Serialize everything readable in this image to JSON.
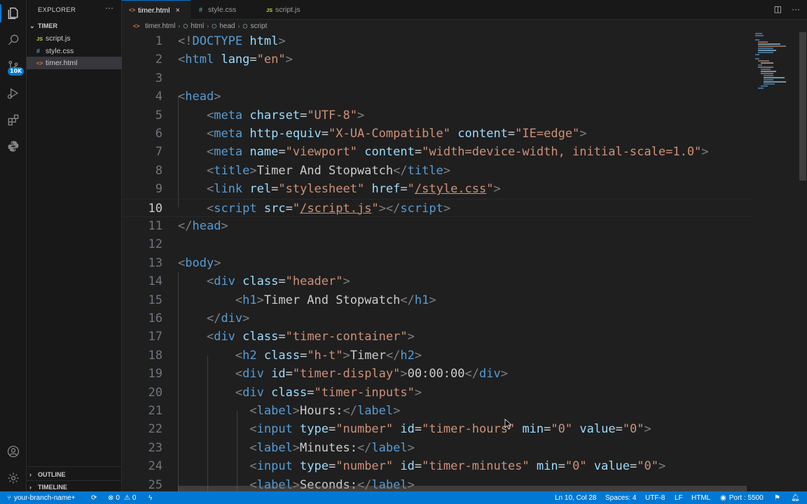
{
  "sidebar": {
    "title": "EXPLORER",
    "more": "···",
    "folder": "TIMER",
    "files": [
      {
        "icon": "JS",
        "name": "script.js"
      },
      {
        "icon": "#",
        "name": "style.css"
      },
      {
        "icon": "<>",
        "name": "timer.html"
      }
    ],
    "outline": "OUTLINE",
    "timeline": "TIMELINE"
  },
  "activity": {
    "badge": "10K"
  },
  "tabs": [
    {
      "icon": "<>",
      "label": "timer.html",
      "close": "×"
    },
    {
      "icon": "#",
      "label": "style.css"
    },
    {
      "icon": "JS",
      "label": "script.js"
    }
  ],
  "breadcrumb": {
    "file_icon": "<>",
    "file": "timer.html",
    "items": [
      "html",
      "head",
      "script"
    ],
    "sep": "›"
  },
  "editor": {
    "current_line": 10,
    "line_numbers": [
      "1",
      "2",
      "3",
      "4",
      "5",
      "6",
      "7",
      "8",
      "9",
      "10",
      "11",
      "12",
      "13",
      "14",
      "15",
      "16",
      "17",
      "18",
      "19",
      "20",
      "21",
      "22",
      "23",
      "24",
      "25"
    ]
  },
  "status": {
    "branch": "your-branch-name+",
    "errors": "0",
    "warnings": "0",
    "position": "Ln 10, Col 28",
    "spaces": "Spaces: 4",
    "encoding": "UTF-8",
    "eol": "LF",
    "language": "HTML",
    "port": "Port : 5500"
  },
  "colors": {
    "accent": "#0078d4",
    "tag": "#569cd6",
    "attribute": "#9cdcfe",
    "string": "#ce9178",
    "punctuation": "#808080"
  }
}
